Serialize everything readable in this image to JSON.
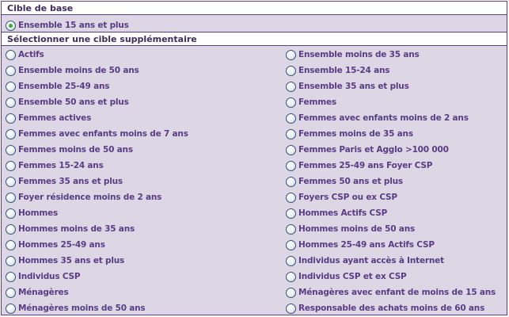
{
  "base_section": {
    "title": "Cible de base",
    "option": {
      "label": "Ensemble 15 ans et plus",
      "selected": true
    }
  },
  "extra_section": {
    "title": "Sélectionner une cible supplémentaire",
    "left_options": [
      "Actifs",
      "Ensemble moins de 50 ans",
      "Ensemble 25-49 ans",
      "Ensemble 50 ans et plus",
      "Femmes actives",
      "Femmes avec enfants moins de 7 ans",
      "Femmes moins de 50 ans",
      "Femmes 15-24 ans",
      "Femmes 35 ans et plus",
      "Foyer résidence moins de 2 ans",
      "Hommes",
      "Hommes moins de 35 ans",
      "Hommes 25-49 ans",
      "Hommes 35 ans et plus",
      "Individus CSP",
      "Ménagères",
      "Ménagères moins de 50 ans"
    ],
    "right_options": [
      "Ensemble moins de 35 ans",
      "Ensemble 15-24 ans",
      "Ensemble 35 ans et plus",
      "Femmes",
      "Femmes avec enfants moins de 2 ans",
      "Femmes moins de 35 ans",
      "Femmes Paris et Agglo >100 000",
      "Femmes 25-49 ans Foyer CSP",
      "Femmes 50 ans et plus",
      "Foyers CSP ou ex CSP",
      "Hommes Actifs CSP",
      "Hommes moins de 50 ans",
      "Hommes 25-49 ans Actifs CSP",
      "Individus ayant accès à Internet",
      "Individus CSP et ex CSP",
      "Ménagères avec enfant de moins de 15 ans",
      "Responsable des achats moins de 60 ans"
    ]
  },
  "colors": {
    "border": "#5b3f82",
    "background": "#ddd7e5",
    "text": "#5b3c84",
    "selected_dot": "#3aa83a"
  }
}
